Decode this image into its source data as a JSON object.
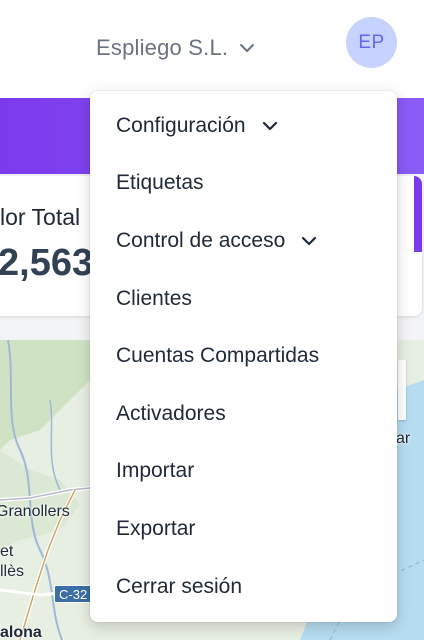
{
  "header": {
    "company_name": "Espliego S.L.",
    "avatar_initials": "EP"
  },
  "stat": {
    "label": "lor Total",
    "value": "2,563"
  },
  "map": {
    "labels": [
      "Granollers",
      "et",
      "llès",
      "alona",
      "ar"
    ],
    "road_badge": "C-32"
  },
  "menu": {
    "items": [
      {
        "label": "Configuración",
        "has_submenu": true
      },
      {
        "label": "Etiquetas",
        "has_submenu": false
      },
      {
        "label": "Control de acceso",
        "has_submenu": true
      },
      {
        "label": "Clientes",
        "has_submenu": false
      },
      {
        "label": "Cuentas Compartidas",
        "has_submenu": false
      },
      {
        "label": "Activadores",
        "has_submenu": false
      },
      {
        "label": "Importar",
        "has_submenu": false
      },
      {
        "label": "Exportar",
        "has_submenu": false
      },
      {
        "label": "Cerrar sesión",
        "has_submenu": false
      }
    ]
  },
  "colors": {
    "accent": "#7c3aed",
    "avatar_bg": "#c7d2fe",
    "avatar_text": "#6366f1"
  }
}
